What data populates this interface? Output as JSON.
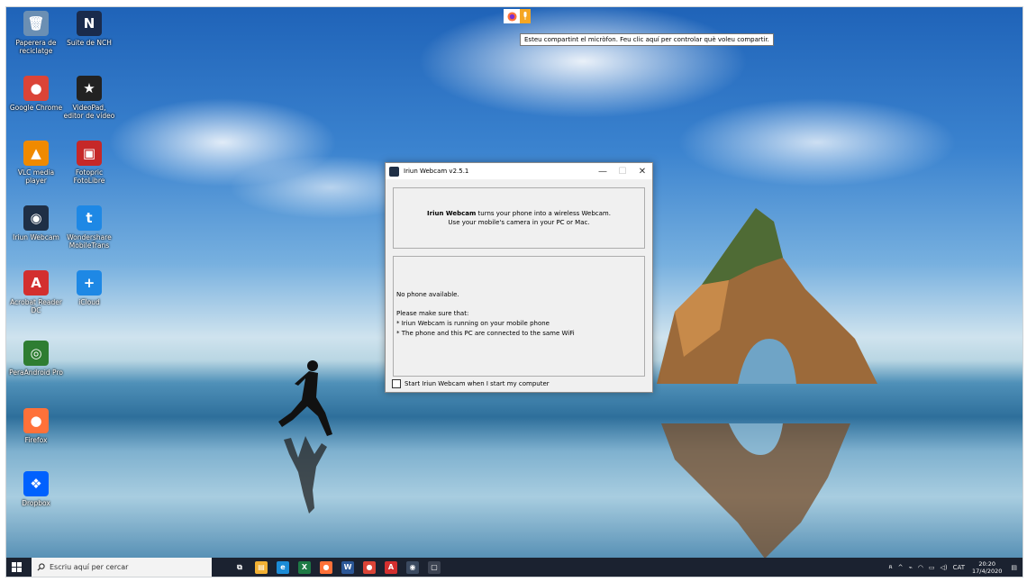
{
  "desktop": {
    "icons": [
      {
        "label": "Paperera de reciclatge",
        "glyph": "🗑",
        "color": "#6b8fb3",
        "icon": "recycle-bin-icon"
      },
      {
        "label": "Suite de NCH",
        "glyph": "N",
        "color": "#1a2b4c",
        "icon": "nch-suite-icon"
      },
      {
        "label": "Google Chrome",
        "glyph": "●",
        "color": "#db4437",
        "icon": "chrome-icon"
      },
      {
        "label": "VideoPad, editor de vídeo",
        "glyph": "★",
        "color": "#222222",
        "icon": "videopad-icon"
      },
      {
        "label": "VLC media player",
        "glyph": "▲",
        "color": "#f08a00",
        "icon": "vlc-icon"
      },
      {
        "label": "Fotopric FotoLibre",
        "glyph": "▣",
        "color": "#c62828",
        "icon": "fotopric-icon"
      },
      {
        "label": "Iriun Webcam",
        "glyph": "◉",
        "color": "#1f2f46",
        "icon": "iriun-webcam-icon"
      },
      {
        "label": "Wondershare MobileTrans",
        "glyph": "t",
        "color": "#1e88e5",
        "icon": "mobiletrans-icon"
      },
      {
        "label": "Acrobat Reader DC",
        "glyph": "A",
        "color": "#d32f2f",
        "icon": "acrobat-icon"
      },
      {
        "label": "iCloud",
        "glyph": "+",
        "color": "#1e88e5",
        "icon": "icloud-icon"
      },
      {
        "label": "PeraAndroid Pro",
        "glyph": "◎",
        "color": "#2e7d32",
        "icon": "peraandroid-icon"
      },
      {
        "label": "Firefox",
        "glyph": "●",
        "color": "#ff7139",
        "icon": "firefox-icon"
      },
      {
        "label": "Dropbox",
        "glyph": "❖",
        "color": "#0061fe",
        "icon": "dropbox-icon"
      }
    ]
  },
  "notification": {
    "tooltip": "Esteu compartint el micròfon. Feu clic aquí per controlar què voleu compartir."
  },
  "window": {
    "title": "Iriun Webcam v2.5.1",
    "intro_bold": "Iriun Webcam",
    "intro_rest": " turns your phone into a wireless Webcam.",
    "intro_line2": "Use your mobile's camera in your PC or Mac.",
    "no_phone": "No phone available.",
    "make_sure": "Please make sure that:",
    "check1": "* Iriun Webcam is running on your mobile phone",
    "check2": "* The phone and this PC are connected to the same WiFi",
    "startup_label": "Start Iriun Webcam when I start my computer",
    "startup_checked": false
  },
  "taskbar": {
    "search_placeholder": "Escriu aquí per cercar",
    "apps": [
      {
        "glyph": "⧉",
        "color": "#1b2230",
        "icon": "task-view-icon"
      },
      {
        "glyph": "▤",
        "color": "#f2b134",
        "icon": "file-explorer-icon"
      },
      {
        "glyph": "e",
        "color": "#1b8bd6",
        "icon": "edge-icon"
      },
      {
        "glyph": "X",
        "color": "#1d7a45",
        "icon": "excel-icon"
      },
      {
        "glyph": "●",
        "color": "#ff7139",
        "icon": "firefox-taskbar-icon"
      },
      {
        "glyph": "W",
        "color": "#2b5797",
        "icon": "word-icon"
      },
      {
        "glyph": "●",
        "color": "#db4437",
        "icon": "chrome-taskbar-icon"
      },
      {
        "glyph": "A",
        "color": "#d32f2f",
        "icon": "acrobat-taskbar-icon"
      },
      {
        "glyph": "◉",
        "color": "#3b4a60",
        "icon": "iriun-taskbar-icon"
      },
      {
        "glyph": "▢",
        "color": "#3c4352",
        "icon": "app-taskbar-icon"
      }
    ],
    "tray": {
      "language": "CAT",
      "time": "20:20",
      "date": "17/4/2020"
    }
  }
}
